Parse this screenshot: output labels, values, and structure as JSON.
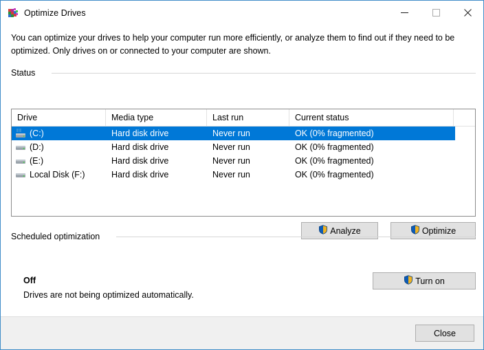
{
  "window": {
    "title": "Optimize Drives",
    "icon": "defrag-icon",
    "controls": {
      "minimize": "minimize-icon",
      "maximize": "maximize-icon",
      "close": "close-icon"
    }
  },
  "intro": {
    "text": "You can optimize your drives to help your computer run more efficiently, or analyze them to find out if they need to be optimized. Only drives on or connected to your computer are shown."
  },
  "status_section": {
    "label": "Status",
    "columns": [
      "Drive",
      "Media type",
      "Last run",
      "Current status"
    ],
    "rows": [
      {
        "drive": "(C:)",
        "media_type": "Hard disk drive",
        "last_run": "Never run",
        "current_status": "OK (0% fragmented)",
        "icon": "system-drive-icon",
        "selected": true
      },
      {
        "drive": "(D:)",
        "media_type": "Hard disk drive",
        "last_run": "Never run",
        "current_status": "OK (0% fragmented)",
        "icon": "drive-icon",
        "selected": false
      },
      {
        "drive": "(E:)",
        "media_type": "Hard disk drive",
        "last_run": "Never run",
        "current_status": "OK (0% fragmented)",
        "icon": "drive-icon",
        "selected": false
      },
      {
        "drive": "Local Disk (F:)",
        "media_type": "Hard disk drive",
        "last_run": "Never run",
        "current_status": "OK (0% fragmented)",
        "icon": "drive-icon",
        "selected": false
      }
    ]
  },
  "actions": {
    "analyze_label": "Analyze",
    "optimize_label": "Optimize",
    "shield_icon": "uac-shield-icon"
  },
  "scheduled_section": {
    "label": "Scheduled optimization",
    "state": "Off",
    "description": "Drives are not being optimized automatically.",
    "turn_on_label": "Turn on"
  },
  "footer": {
    "close_label": "Close"
  },
  "colors": {
    "selection_blue": "#0078d7",
    "window_border": "#3f8cc8",
    "button_face": "#e1e1e1",
    "footer_bg": "#f0f0f0",
    "shield_blue": "#0d5bb5",
    "shield_gold": "#f0b323"
  }
}
